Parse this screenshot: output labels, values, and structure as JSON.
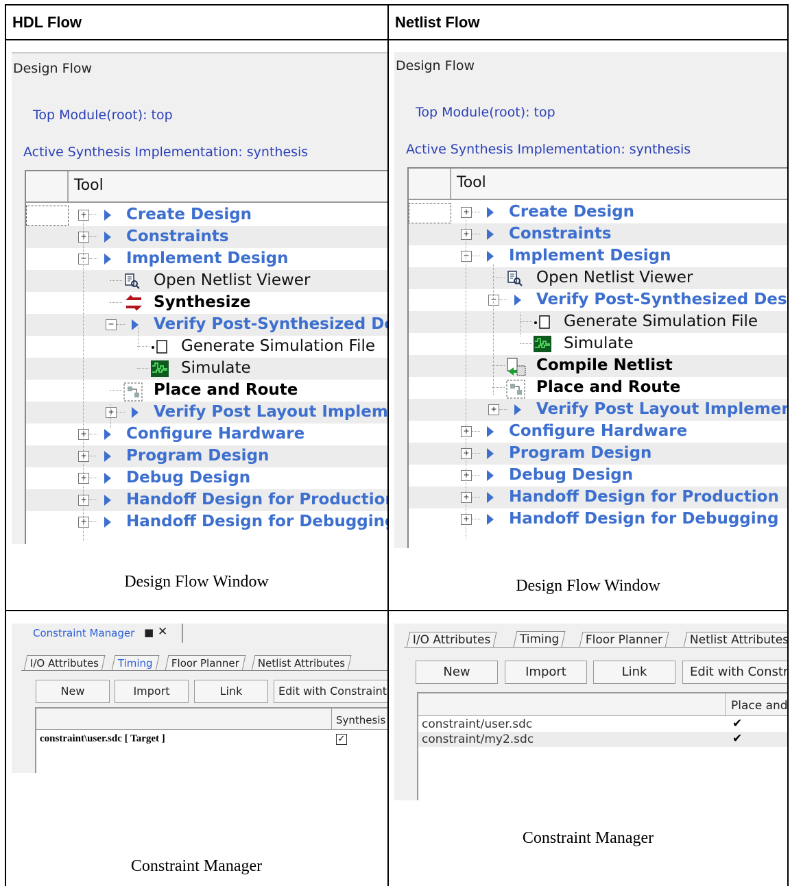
{
  "left_header": "HDL Flow",
  "right_header": "Netlist Flow",
  "captions": {
    "left_top": "Design Flow Window",
    "right_top": "Design Flow Window",
    "left_bottom": "Constraint Manager",
    "right_bottom": "Constraint Manager"
  },
  "hdl_design_flow": {
    "title": "Design Flow",
    "top_module": "Top Module(root): top",
    "active_synthesis": "Active Synthesis Implementation: synthesis",
    "tool_header": "Tool",
    "rows": [
      {
        "label": "Create Design",
        "style": "link",
        "expander": "+"
      },
      {
        "label": "Constraints",
        "style": "link",
        "expander": "+"
      },
      {
        "label": "Implement Design",
        "style": "link",
        "expander": "-"
      },
      {
        "label": "Open Netlist Viewer",
        "style": "plain",
        "icon": "netlist-viewer-icon"
      },
      {
        "label": "Synthesize",
        "style": "bold",
        "icon": "synthesize-icon"
      },
      {
        "label": "Verify Post-Synthesized Design",
        "style": "link",
        "expander": "-"
      },
      {
        "label": "Generate Simulation File",
        "style": "plain",
        "icon": "file-icon"
      },
      {
        "label": "Simulate",
        "style": "plain",
        "icon": "simulate-icon"
      },
      {
        "label": "Place and Route",
        "style": "bold",
        "icon": "place-route-icon"
      },
      {
        "label": "Verify Post Layout Implementation",
        "style": "link",
        "expander": "+"
      },
      {
        "label": "Configure Hardware",
        "style": "link",
        "expander": "+"
      },
      {
        "label": "Program Design",
        "style": "link",
        "expander": "+"
      },
      {
        "label": "Debug Design",
        "style": "link",
        "expander": "+"
      },
      {
        "label": "Handoff Design for Production",
        "style": "link",
        "expander": "+"
      },
      {
        "label": "Handoff Design for Debugging",
        "style": "link",
        "expander": "+"
      }
    ]
  },
  "netlist_design_flow": {
    "title": "Design Flow",
    "top_module": "Top Module(root): top",
    "active_synthesis": "Active Synthesis Implementation: synthesis",
    "tool_header": "Tool",
    "rows": [
      {
        "label": "Create Design",
        "style": "link",
        "expander": "+"
      },
      {
        "label": "Constraints",
        "style": "link",
        "expander": "+"
      },
      {
        "label": "Implement Design",
        "style": "link",
        "expander": "-"
      },
      {
        "label": "Open Netlist Viewer",
        "style": "plain",
        "icon": "netlist-viewer-icon"
      },
      {
        "label": "Verify Post-Synthesized Design",
        "style": "link",
        "expander": "-"
      },
      {
        "label": "Generate Simulation File",
        "style": "plain",
        "icon": "file-icon"
      },
      {
        "label": "Simulate",
        "style": "plain",
        "icon": "simulate-icon"
      },
      {
        "label": "Compile Netlist",
        "style": "bold",
        "icon": "compile-icon"
      },
      {
        "label": "Place and Route",
        "style": "bold",
        "icon": "place-route-icon"
      },
      {
        "label": "Verify Post Layout Implementation",
        "style": "link",
        "expander": "+"
      },
      {
        "label": "Configure Hardware",
        "style": "link",
        "expander": "+"
      },
      {
        "label": "Program Design",
        "style": "link",
        "expander": "+"
      },
      {
        "label": "Debug Design",
        "style": "link",
        "expander": "+"
      },
      {
        "label": "Handoff Design for Production",
        "style": "link",
        "expander": "+"
      },
      {
        "label": "Handoff Design for Debugging",
        "style": "link",
        "expander": "+"
      }
    ]
  },
  "hdl_constraint_manager": {
    "title": "Constraint Manager",
    "tabs": [
      "I/O Attributes",
      "Timing",
      "Floor Planner",
      "Netlist Attributes"
    ],
    "active_tab": "Timing",
    "buttons": [
      "New",
      "Import",
      "Link",
      "Edit with Constraint Editor"
    ],
    "column": "Synthesis",
    "rows": [
      {
        "file": "constraint\\user.sdc",
        "target": "[ Target ]",
        "checked": true
      }
    ]
  },
  "netlist_constraint_manager": {
    "tabs": [
      "I/O Attributes",
      "Timing",
      "Floor Planner",
      "Netlist Attributes"
    ],
    "active_tab": "Timing",
    "buttons": [
      "New",
      "Import",
      "Link",
      "Edit with Constraint Editor"
    ],
    "column": "Place and Route",
    "rows": [
      {
        "file": "constraint/user.sdc",
        "checked": true
      },
      {
        "file": "constraint/my2.sdc",
        "checked": true
      }
    ]
  },
  "colors": {
    "link": "#3d6fcf",
    "header_blue": "#2a3fb8"
  }
}
